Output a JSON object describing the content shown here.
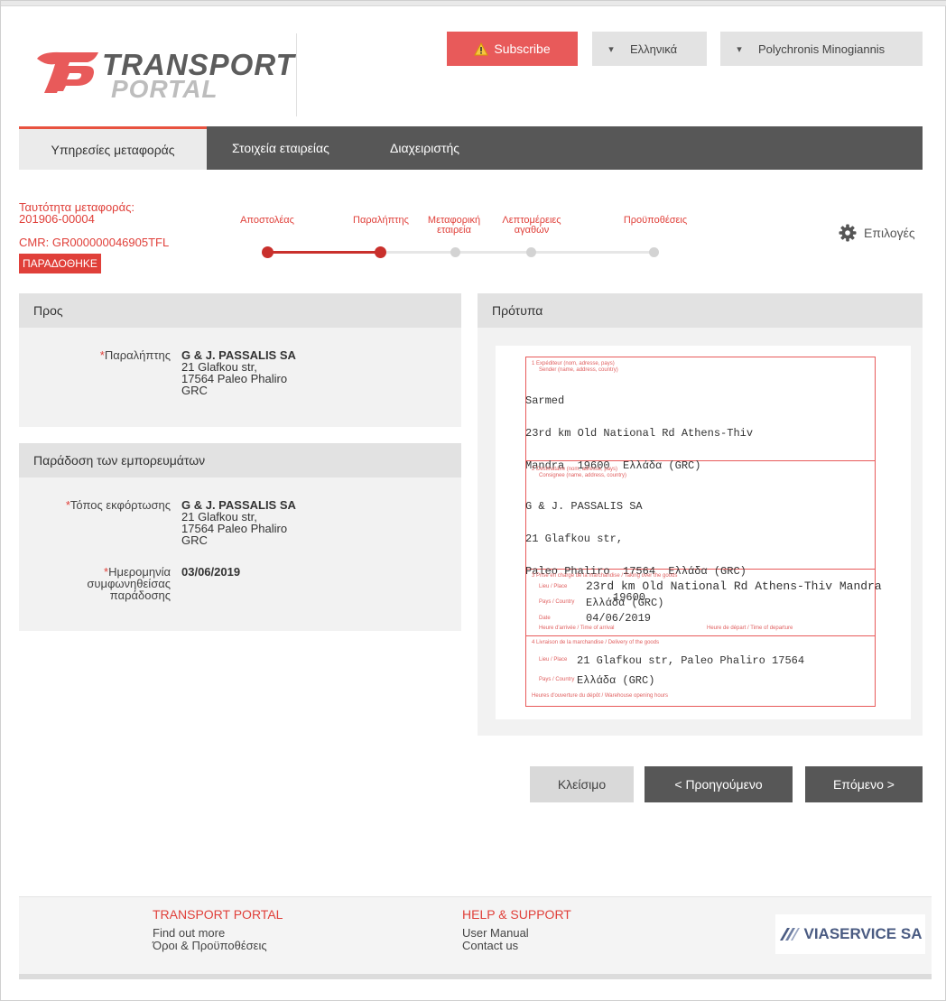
{
  "header": {
    "logo_line1": "TRANSPORT",
    "logo_line2": "PORTAL",
    "subscribe_label": "Subscribe",
    "language": "Ελληνικά",
    "user": "Polychronis Minogiannis"
  },
  "tabs": [
    {
      "label": "Υπηρεσίες μεταφοράς"
    },
    {
      "label": "Στοιχεία εταιρείας"
    },
    {
      "label": "Διαχειριστής"
    }
  ],
  "shipment": {
    "id_label": "Ταυτότητα μεταφοράς:",
    "id_value": "201906-00004",
    "cmr": "CMR: GR000000046905TFL",
    "status": "ΠΑΡΑΔΟΘΗΚΕ"
  },
  "stepper": {
    "steps": [
      {
        "label": "Αποστολέας",
        "done": true
      },
      {
        "label": "Παραλήπτης",
        "done": true
      },
      {
        "label": "Μεταφορική εταιρεία",
        "done": false
      },
      {
        "label": "Λεπτομέρειες αγαθών",
        "done": false
      },
      {
        "label": "Προϋποθέσεις",
        "done": false
      }
    ],
    "options_label": "Επιλογές"
  },
  "to_panel": {
    "title": "Προς",
    "recipient_label": "Παραλήπτης",
    "recipient_name": "G & J. PASSALIS SA",
    "recipient_line1": "21 Glafkou str,",
    "recipient_line2": "17564 Paleo Phaliro",
    "recipient_line3": "GRC"
  },
  "delivery_panel": {
    "title": "Παράδοση των εμπορευμάτων",
    "unload_label": "Τόπος εκφόρτωσης",
    "unload_name": "G & J. PASSALIS SA",
    "unload_line1": "21 Glafkou str,",
    "unload_line2": "17564 Paleo Phaliro",
    "unload_line3": "GRC",
    "date_label_1": "Ημερομηνία",
    "date_label_2": "συμφωνηθείσας",
    "date_label_3": "παράδοσης",
    "date_value": "03/06/2019"
  },
  "preview_panel": {
    "title": "Πρότυπα",
    "box1": {
      "num": "1",
      "caption1": "Expéditeur (nom, adresse, pays)",
      "caption2": "Sender (name, address, country)",
      "line1": "Sarmed",
      "line2": "23rd km Old National Rd Athens-Thiv",
      "line3": "Mandra  19600  Ελλάδα (GRC)"
    },
    "box2": {
      "num": "2",
      "caption1": "Destinataire (nom, adresse, pays)",
      "caption2": "Consignee (name, address, country)",
      "line1": "G & J. PASSALIS SA",
      "line2": "21 Glafkou str,",
      "line3": "Paleo Phaliro  17564  Ελλάδα (GRC)"
    },
    "box3": {
      "num": "3",
      "caption1": "Prise en charge de la marchandise / Taking over the goods",
      "place_label": "Lieu / Place",
      "place_value": "23rd km Old National Rd Athens-Thiv Mandra",
      "place_value2": "19600",
      "country_label": "Pays / Country",
      "country_value": "Ελλάδα (GRC)",
      "date_label": "Date",
      "date_value": "04/06/2019",
      "arrival": "Heure d'arrivée / Time of arrival",
      "departure": "Heure de départ / Time of departure"
    },
    "box4": {
      "num": "4",
      "caption1": "Livraison de la marchandise / Delivery of the goods",
      "place_label": "Lieu / Place",
      "place_value": "21 Glafkou str, Paleo Phaliro 17564",
      "country_label": "Pays / Country",
      "country_value": "Ελλάδα (GRC)",
      "hours": "Heures d'ouverture du dépôt / Warehouse opening hours"
    }
  },
  "buttons": {
    "close": "Κλείσιμο",
    "prev": "< Προηγούμενο",
    "next": "Επόμενο >"
  },
  "footer": {
    "col1_title": "TRANSPORT PORTAL",
    "col1_link1": "Find out more",
    "col1_link2": "Όροι & Προϋποθέσεις",
    "col2_title": "HELP & SUPPORT",
    "col2_link1": "User Manual",
    "col2_link2": "Contact us",
    "brand": "VIASERVICE SA"
  },
  "colors": {
    "accent": "#e0403a",
    "dark": "#575757"
  }
}
